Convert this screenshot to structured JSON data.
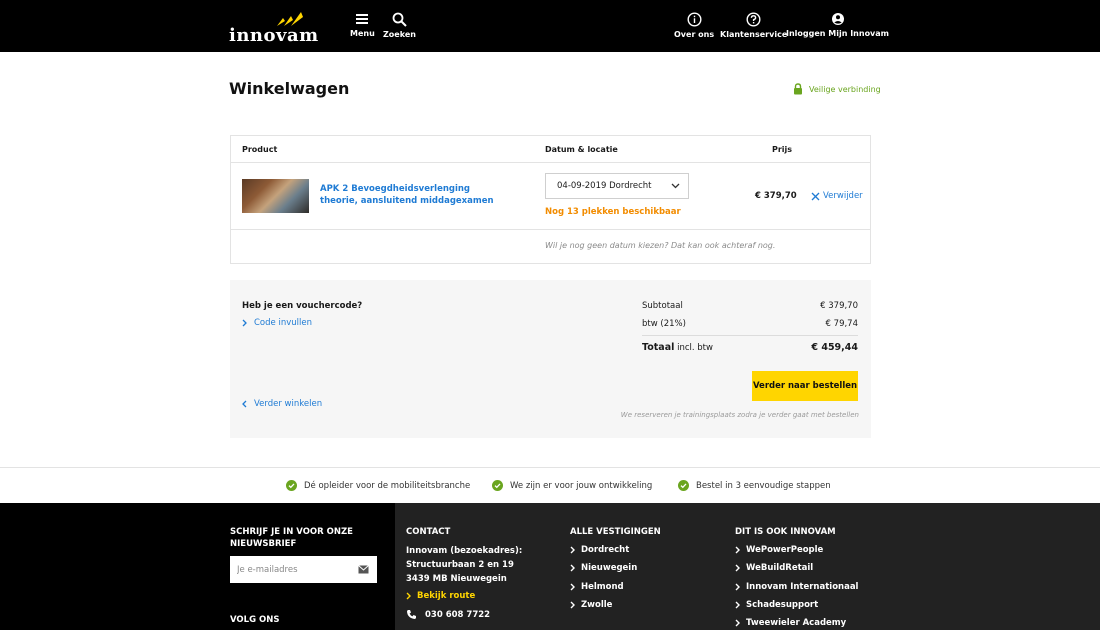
{
  "header": {
    "logo_text": "innovam",
    "nav_left": [
      {
        "label": "Menu",
        "icon": "hamburger-icon"
      },
      {
        "label": "Zoeken",
        "icon": "search-icon"
      }
    ],
    "nav_right": [
      {
        "label": "Over ons",
        "icon": "info-icon"
      },
      {
        "label": "Klantenservice",
        "icon": "help-icon"
      },
      {
        "label": "Inloggen Mijn Innovam",
        "icon": "user-icon"
      }
    ]
  },
  "page": {
    "title": "Winkelwagen",
    "secure_label": "Veilige verbinding"
  },
  "cart": {
    "columns": {
      "product": "Product",
      "date_location": "Datum & locatie",
      "price": "Prijs"
    },
    "items": [
      {
        "name": "APK 2 Bevoegdheidsverlenging theorie, aansluitend middagexamen",
        "selected_date": "04-09-2019 Dordrecht",
        "availability": "Nog 13 plekken beschikbaar",
        "price": "€ 379,70",
        "remove_label": "Verwijder"
      }
    ],
    "date_later_note": "Wil je nog geen datum kiezen? Dat kan ook achteraf nog."
  },
  "summary": {
    "voucher_question": "Heb je een vouchercode?",
    "voucher_link": "Code invullen",
    "subtotal_label": "Subtotaal",
    "subtotal_value": "€ 379,70",
    "vat_label": "btw (21%)",
    "vat_value": "€ 79,74",
    "total_label": "Totaal",
    "total_suffix": "incl. btw",
    "total_value": "€ 459,44",
    "continue_shopping": "Verder winkelen",
    "order_button": "Verder naar bestellen",
    "reserve_note": "We reserveren je trainingsplaats zodra je verder gaat met bestellen"
  },
  "usps": [
    "Dé opleider voor de mobiliteitsbranche",
    "We zijn er voor jouw ontwikkeling",
    "Bestel in 3 eenvoudige stappen"
  ],
  "footer": {
    "newsletter_title": "Schrijf je in voor onze nieuwsbrief",
    "email_placeholder": "Je e-mailadres",
    "follow_title": "Volg ons",
    "contact_title": "Contact",
    "contact_name": "Innovam (bezoekadres):",
    "contact_street": "Structuurbaan 2 en 19",
    "contact_city": "3439 MB Nieuwegein",
    "route_link": "Bekijk route",
    "phone": "030 608 7722",
    "locations_title": "Alle vestigingen",
    "locations": [
      "Dordrecht",
      "Nieuwegein",
      "Helmond",
      "Zwolle"
    ],
    "also_title": "Dit is ook Innovam",
    "also_links": [
      "WePowerPeople",
      "WeBuildRetail",
      "Innovam Internationaal",
      "Schadesupport",
      "Tweewieler Academy"
    ]
  },
  "colors": {
    "accent_blue": "#1f7bd4",
    "accent_yellow": "#ffd500",
    "secure_green": "#6aa51f",
    "availability_orange": "#f28c00"
  }
}
